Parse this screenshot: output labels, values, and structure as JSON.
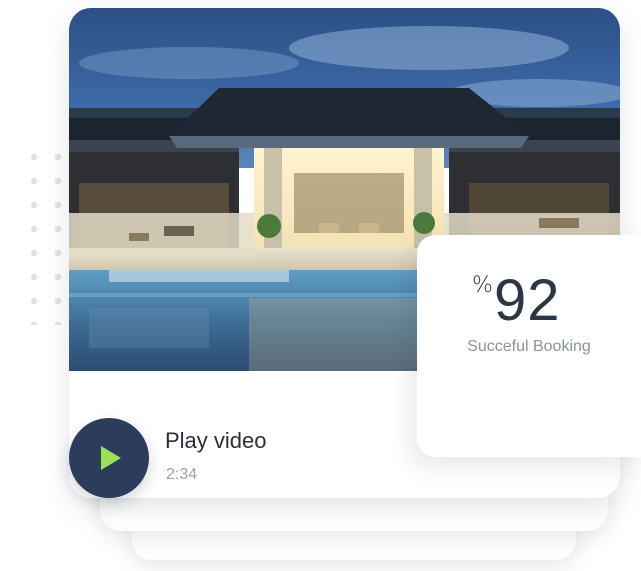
{
  "stat": {
    "percent_symbol": "%",
    "value": "92",
    "label": "Succeful Booking"
  },
  "video": {
    "title": "Play video",
    "duration": "2:34",
    "play_icon": "play-icon"
  },
  "colors": {
    "play_button_bg": "#2b3d5a",
    "play_icon": "#9be25a",
    "stat_text": "#2c3645",
    "label_text": "#8a939e"
  },
  "image": {
    "subject": "hotel-exterior-at-dusk-with-pool"
  }
}
